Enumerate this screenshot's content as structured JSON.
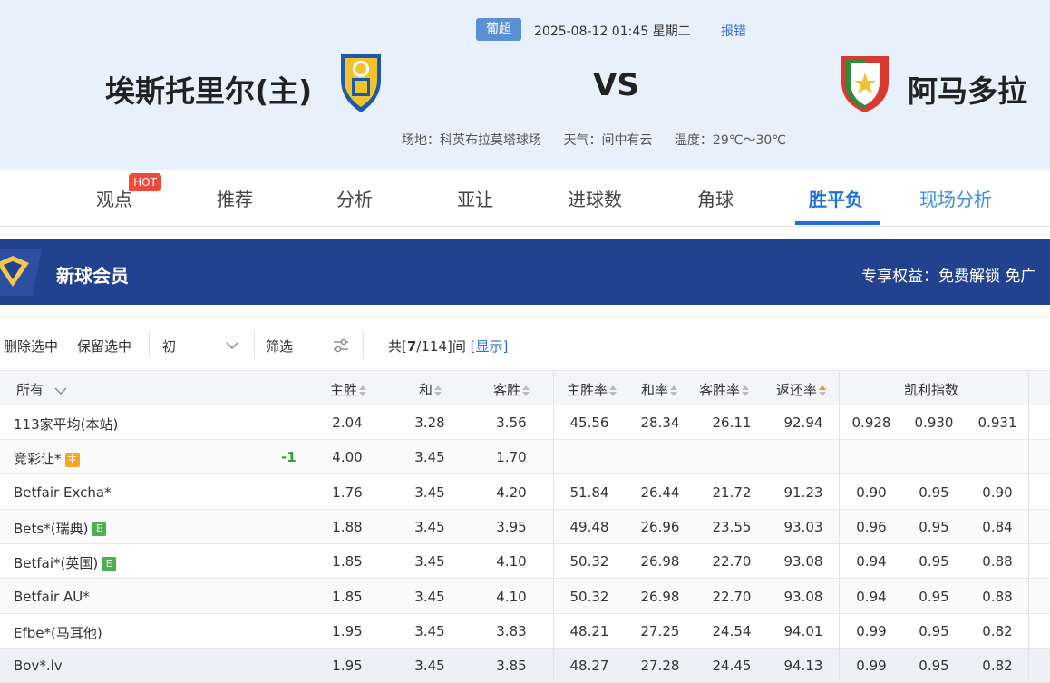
{
  "header": {
    "league": "葡超",
    "datetime": "2025-08-12 01:45 星期二",
    "report_label": "报错",
    "home_team": "埃斯托里尔(主)",
    "away_team": "阿马多拉",
    "vs_label": "VS",
    "venue": "场地：科英布拉莫塔球场",
    "weather": "天气：间中有云",
    "temperature": "温度：29℃～30℃"
  },
  "tabs": [
    {
      "label": "观点"
    },
    {
      "label": "推荐"
    },
    {
      "label": "分析"
    },
    {
      "label": "亚让"
    },
    {
      "label": "进球数"
    },
    {
      "label": "角球"
    },
    {
      "label": "胜平负"
    },
    {
      "label": "现场分析"
    }
  ],
  "hot_label": "HOT",
  "banner": {
    "title": "新球会员",
    "perks": "专享权益：免费解锁 免广"
  },
  "toolbar": {
    "delete_selected": "删除选中",
    "keep_selected": "保留选中",
    "odds_type": "初",
    "filter": "筛选",
    "count_prefix": "共[",
    "count_shown": "7",
    "count_total": "/114]间",
    "show_link": "[显示]"
  },
  "table": {
    "headers": {
      "company": "所有",
      "home": "主胜",
      "draw": "和",
      "away": "客胜",
      "home_rate": "主胜率",
      "draw_rate": "和率",
      "away_rate": "客胜率",
      "return_rate": "返还率",
      "kelly": "凯利指数"
    },
    "rows": [
      {
        "name": "113家平均(本站)",
        "tag": "",
        "handicap": "",
        "home": "2.04",
        "draw": "3.28",
        "away": "3.56",
        "home_rate": "45.56",
        "draw_rate": "28.34",
        "away_rate": "26.11",
        "return_rate": "92.94",
        "k1": "0.928",
        "k2": "0.930",
        "k3": "0.931"
      },
      {
        "name": "竞彩让*",
        "tag": "主",
        "handicap": "-1",
        "home": "4.00",
        "draw": "3.45",
        "away": "1.70",
        "home_rate": "",
        "draw_rate": "",
        "away_rate": "",
        "return_rate": "",
        "k1": "",
        "k2": "",
        "k3": ""
      },
      {
        "name": "Betfair Excha*",
        "tag": "",
        "handicap": "",
        "home": "1.76",
        "draw": "3.45",
        "away": "4.20",
        "home_rate": "51.84",
        "draw_rate": "26.44",
        "away_rate": "21.72",
        "return_rate": "91.23",
        "k1": "0.90",
        "k2": "0.95",
        "k3": "0.90"
      },
      {
        "name": "Bets*(瑞典)",
        "tag": "E",
        "handicap": "",
        "home": "1.88",
        "draw": "3.45",
        "away": "3.95",
        "home_rate": "49.48",
        "draw_rate": "26.96",
        "away_rate": "23.55",
        "return_rate": "93.03",
        "k1": "0.96",
        "k2": "0.95",
        "k3": "0.84"
      },
      {
        "name": "Betfai*(英国)",
        "tag": "E",
        "handicap": "",
        "home": "1.85",
        "draw": "3.45",
        "away": "4.10",
        "home_rate": "50.32",
        "draw_rate": "26.98",
        "away_rate": "22.70",
        "return_rate": "93.08",
        "k1": "0.94",
        "k2": "0.95",
        "k3": "0.88"
      },
      {
        "name": "Betfair AU*",
        "tag": "",
        "handicap": "",
        "home": "1.85",
        "draw": "3.45",
        "away": "4.10",
        "home_rate": "50.32",
        "draw_rate": "26.98",
        "away_rate": "22.70",
        "return_rate": "93.08",
        "k1": "0.94",
        "k2": "0.95",
        "k3": "0.88"
      },
      {
        "name": "Efbe*(马耳他)",
        "tag": "",
        "handicap": "",
        "home": "1.95",
        "draw": "3.45",
        "away": "3.83",
        "home_rate": "48.21",
        "draw_rate": "27.25",
        "away_rate": "24.54",
        "return_rate": "94.01",
        "k1": "0.99",
        "k2": "0.95",
        "k3": "0.82"
      },
      {
        "name": "Bov*.lv",
        "tag": "",
        "handicap": "",
        "home": "1.95",
        "draw": "3.45",
        "away": "3.85",
        "home_rate": "48.27",
        "draw_rate": "27.28",
        "away_rate": "24.45",
        "return_rate": "94.13",
        "k1": "0.99",
        "k2": "0.95",
        "k3": "0.82"
      }
    ]
  },
  "colors": {
    "accent": "#1e6fd9",
    "banner_bg": "#22428f",
    "header_bg": "#e8f1fb",
    "hot": "#f04a3d"
  }
}
